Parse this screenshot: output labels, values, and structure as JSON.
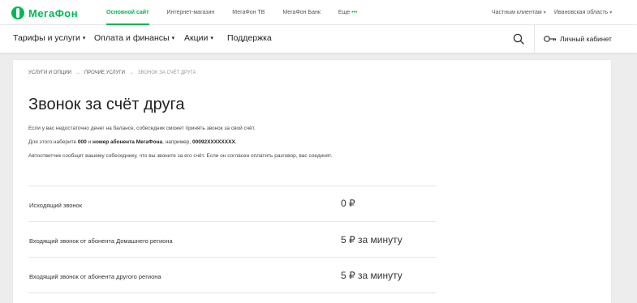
{
  "brand": {
    "name": "МегаФон",
    "accent": "#00b956"
  },
  "topbar": {
    "links": [
      {
        "label": "Основной сайт",
        "active": true
      },
      {
        "label": "Интернет-магазин"
      },
      {
        "label": "МегаФон ТВ"
      },
      {
        "label": "МегаФон Банк"
      },
      {
        "label": "Еще",
        "suffix": "•••"
      }
    ],
    "segment": "Частным клиентам",
    "region": "Ивановская область"
  },
  "nav": {
    "items": [
      {
        "label": "Тарифы и услуги",
        "dropdown": true
      },
      {
        "label": "Оплата и финансы",
        "dropdown": true
      },
      {
        "label": "Акции",
        "dropdown": true
      },
      {
        "label": "Поддержка",
        "dropdown": false
      }
    ],
    "cabinet_label": "Личный кабинет",
    "icons": {
      "search": "search-icon",
      "cabinet": "key-icon"
    }
  },
  "breadcrumb": {
    "items": [
      "УСЛУГИ И ОПЦИИ",
      "ПРОЧИЕ УСЛУГИ"
    ],
    "separator": "→",
    "current": "ЗВОНОК ЗА СЧЁТ ДРУГА"
  },
  "page": {
    "title": "Звонок за счёт друга",
    "intro": "Если у вас недостаточно денег на балансе, собеседник сможет принять звонок за свой счёт.",
    "dial": {
      "prefix": "Для этого наберите ",
      "code": "000",
      "and": " и ",
      "number_label": "номер абонента МегаФона",
      "example_prefix": ", например, ",
      "example": "00092XXXXXXXX",
      "end": "."
    },
    "autoreply": "Автоответчик сообщит вашему собеседнику, что вы звоните за его счёт. Если он согласен оплатить разговор, вас соединят."
  },
  "prices": [
    {
      "label": "Исходящий звонок",
      "price": "0 ₽"
    },
    {
      "label": "Входящий звонок от абонента Домашнего региона",
      "price": "5 ₽ за минуту"
    },
    {
      "label": "Входящий звонок от абонента другого региона",
      "price": "5 ₽ за минуту"
    }
  ]
}
